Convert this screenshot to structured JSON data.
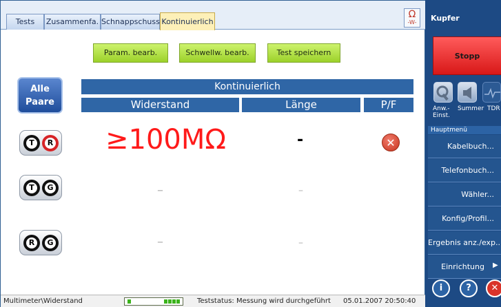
{
  "tabs": [
    {
      "label": "Tests",
      "active": false
    },
    {
      "label": "Zusammenfa.",
      "active": false
    },
    {
      "label": "Schnappschuss",
      "active": false
    },
    {
      "label": "Kontinuierlich",
      "active": true
    }
  ],
  "help_icon": {
    "symbol": "Ω",
    "sub": "-W-",
    "icon": "ohm-icon"
  },
  "actions": {
    "edit_params": "Param. bearb.",
    "edit_thresholds": "Schwellw. bearb.",
    "save_test": "Test speichern"
  },
  "all_pairs": {
    "line1": "Alle",
    "line2": "Paare"
  },
  "table": {
    "title": "Kontinuierlich",
    "columns": {
      "resistance": "Widerstand",
      "length": "Länge",
      "pf": "P/F"
    },
    "rows": [
      {
        "pair": [
          "T",
          "R"
        ],
        "resistance": "≥100MΩ",
        "length": "-",
        "pf": "fail"
      },
      {
        "pair": [
          "T",
          "G"
        ],
        "resistance": "–",
        "length": "–",
        "pf": ""
      },
      {
        "pair": [
          "R",
          "G"
        ],
        "resistance": "–",
        "length": "–",
        "pf": ""
      }
    ]
  },
  "status": {
    "path": "Multimeter\\Widerstand",
    "progress_filled_segments": 5,
    "test_status": "Teststatus: Messung wird durchgeführt",
    "datetime": "05.01.2007 20:50:40"
  },
  "sidebar": {
    "title": "Kupfer",
    "stop_label": "Stopp",
    "tools": [
      {
        "label": "Anw.-\nEinst.",
        "icon": "wrench-icon"
      },
      {
        "label": "Summer",
        "icon": "speaker-icon"
      },
      {
        "label": "TDR",
        "icon": "waveform-icon"
      }
    ],
    "menu_header": "Hauptmenü",
    "menu_items": [
      "Kabelbuch...",
      "Telefonbuch...",
      "Wähler...",
      "Konfig/Profil...",
      "Ergebnis anz./exp...",
      "Einrichtung"
    ],
    "bottom_icons": [
      "info-icon",
      "help-icon",
      "close-icon"
    ]
  },
  "colors": {
    "accent": "#2f66a6",
    "sidebar": "#1d4a84",
    "stop": "#e52222",
    "action": "#b6e34a",
    "value_red": "#ff1a1a"
  }
}
